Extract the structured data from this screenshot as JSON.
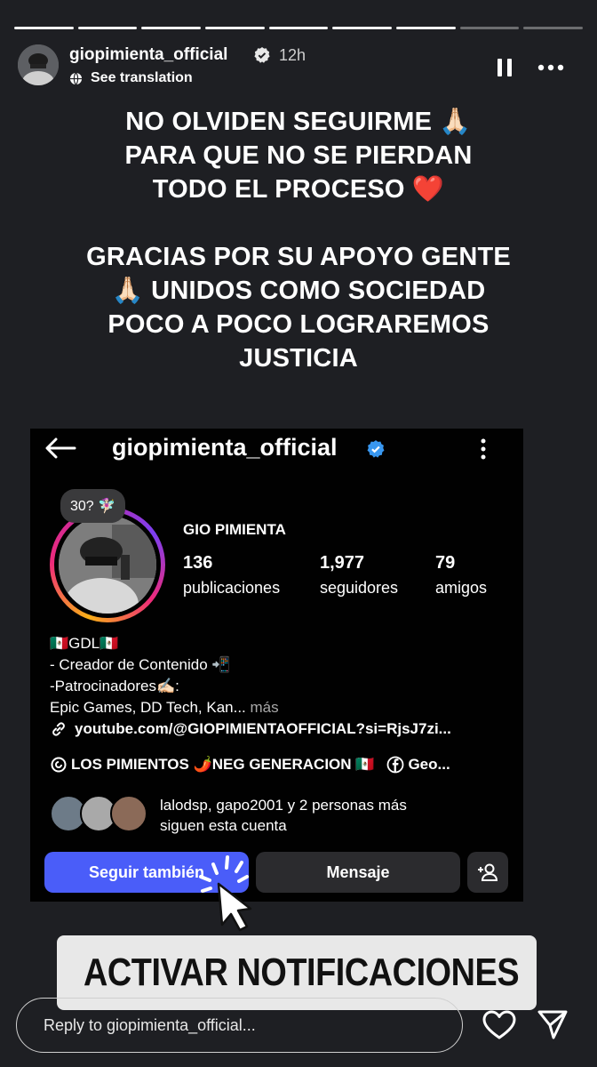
{
  "story": {
    "progress_segments": 9,
    "progress_done": 7,
    "username": "giopimienta_official",
    "time": "12h",
    "see_translation": "See translation",
    "caption": [
      "NO OLVIDEN SEGUIRME 🙏🏻\nPARA QUE NO SE PIERDAN\nTODO EL PROCESO ❤️",
      "GRACIAS POR SU APOYO GENTE\n🙏🏻 UNIDOS COMO SOCIEDAD\nPOCO A POCO LOGRAREMOS\nJUSTICIA"
    ]
  },
  "profile": {
    "username": "giopimienta_official",
    "note": "30? 🧚🏻‍♀️",
    "display_name": "GIO PIMIENTA",
    "stats": [
      {
        "value": "136",
        "label": "publicaciones"
      },
      {
        "value": "1,977",
        "label": "seguidores"
      },
      {
        "value": "79",
        "label": "amigos"
      }
    ],
    "bio_line1": "🇲🇽GDL🇲🇽",
    "bio_line2": "- Creador de Contenido 📲",
    "bio_line3": "-Patrocinadores✍🏻:",
    "bio_line4": "Epic Games, DD Tech, Kan...",
    "bio_more": " más",
    "link": "youtube.com/@GIOPIMIENTAOFFICIAL?si=RjsJ7zi...",
    "tag1": "LOS PIMIENTOS 🌶️NEG GENERACION 🇲🇽",
    "tag2": "Geo...",
    "followed_by_line1": "lalodsp, gapo2001 y 2 personas más",
    "followed_by_line2": "siguen esta cuenta",
    "follow_button": "Seguir también",
    "message_button": "Mensaje"
  },
  "sticker": {
    "text": "ACTIVAR NOTIFICACIONES",
    "bell_icon": "bell-icon"
  },
  "reply": {
    "placeholder": "Reply to giopimienta_official..."
  },
  "colors": {
    "background": "#1e1f23",
    "follow_blue": "#4a5df9",
    "verified_blue": "#3897f0",
    "sticker_bg": "#e8e8e8"
  }
}
